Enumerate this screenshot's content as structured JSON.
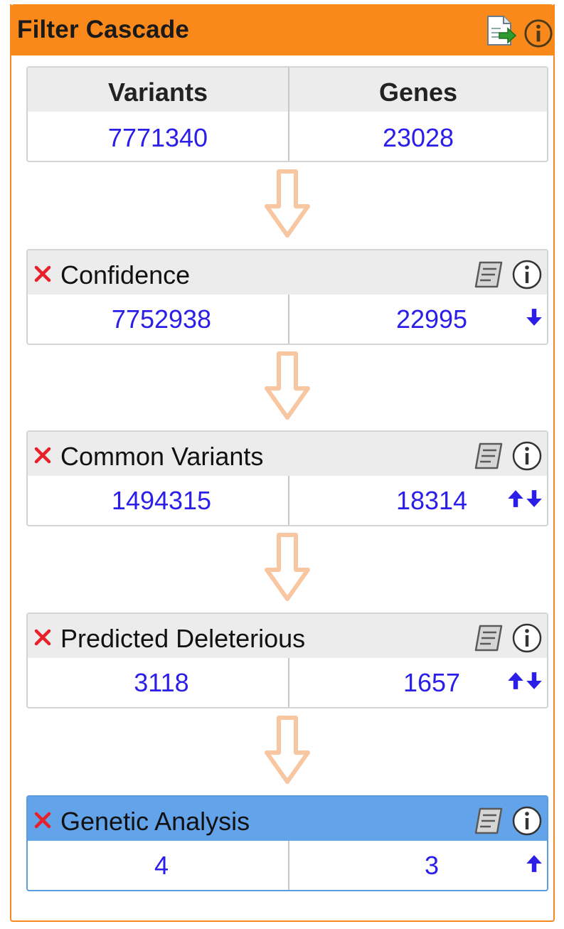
{
  "panel": {
    "title": "Filter Cascade",
    "export_icon": "export-document-icon",
    "info_icon": "info-icon",
    "header_color": "#f8891a"
  },
  "summary": {
    "variants_label": "Variants",
    "genes_label": "Genes",
    "variants": "7771340",
    "genes": "23028"
  },
  "filters": [
    {
      "name": "Confidence",
      "variants": "7752938",
      "genes": "22995",
      "arrows": [
        "down"
      ],
      "active": false
    },
    {
      "name": "Common Variants",
      "variants": "1494315",
      "genes": "18314",
      "arrows": [
        "up",
        "down"
      ],
      "active": false
    },
    {
      "name": "Predicted Deleterious",
      "variants": "3118",
      "genes": "1657",
      "arrows": [
        "up",
        "down"
      ],
      "active": false
    },
    {
      "name": "Genetic Analysis",
      "variants": "4",
      "genes": "3",
      "arrows": [
        "up"
      ],
      "active": true
    }
  ],
  "colors": {
    "number": "#2a1ee8",
    "remove": "#e8202a",
    "flow_arrow": "#f9c6a2",
    "active_header": "#63a3ea"
  }
}
